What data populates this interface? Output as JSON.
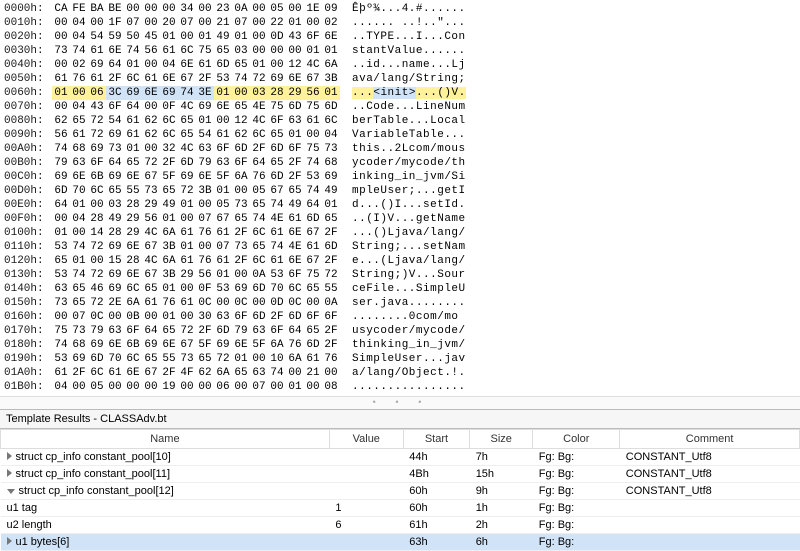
{
  "hex": {
    "rows": [
      {
        "addr": "0000h:",
        "bytes": [
          "CA",
          "FE",
          "BA",
          "BE",
          "00",
          "00",
          "00",
          "34",
          "00",
          "23",
          "0A",
          "00",
          "05",
          "00",
          "1E",
          "09"
        ],
        "ascii": "Êþº¾...4.#......",
        "hl": []
      },
      {
        "addr": "0010h:",
        "bytes": [
          "00",
          "04",
          "00",
          "1F",
          "07",
          "00",
          "20",
          "07",
          "00",
          "21",
          "07",
          "00",
          "22",
          "01",
          "00",
          "02"
        ],
        "ascii": "...... ..!..\"...",
        "hl": []
      },
      {
        "addr": "0020h:",
        "bytes": [
          "00",
          "04",
          "54",
          "59",
          "50",
          "45",
          "01",
          "00",
          "01",
          "49",
          "01",
          "00",
          "0D",
          "43",
          "6F",
          "6E"
        ],
        "ascii": "..TYPE...I...Con",
        "hl": []
      },
      {
        "addr": "0030h:",
        "bytes": [
          "73",
          "74",
          "61",
          "6E",
          "74",
          "56",
          "61",
          "6C",
          "75",
          "65",
          "03",
          "00",
          "00",
          "00",
          "01",
          "01"
        ],
        "ascii": "stantValue......",
        "hl": []
      },
      {
        "addr": "0040h:",
        "bytes": [
          "00",
          "02",
          "69",
          "64",
          "01",
          "00",
          "04",
          "6E",
          "61",
          "6D",
          "65",
          "01",
          "00",
          "12",
          "4C",
          "6A"
        ],
        "ascii": "..id...name...Lj",
        "hl": []
      },
      {
        "addr": "0050h:",
        "bytes": [
          "61",
          "76",
          "61",
          "2F",
          "6C",
          "61",
          "6E",
          "67",
          "2F",
          "53",
          "74",
          "72",
          "69",
          "6E",
          "67",
          "3B"
        ],
        "ascii": "ava/lang/String;",
        "hl": []
      },
      {
        "addr": "0060h:",
        "bytes": [
          "01",
          "00",
          "06",
          "3C",
          "69",
          "6E",
          "69",
          "74",
          "3E",
          "01",
          "00",
          "03",
          "28",
          "29",
          "56",
          "01"
        ],
        "ascii": "...<init>...()V.",
        "hl": [
          {
            "cls": "hl-yellow",
            "from": 0,
            "to": 15
          },
          {
            "cls": "hl-blue",
            "from": 3,
            "to": 8
          }
        ],
        "ascii_hl": [
          {
            "cls": "hl-yellow",
            "from": 0,
            "to": 15
          },
          {
            "cls": "hl-blue",
            "from": 3,
            "to": 8
          }
        ]
      },
      {
        "addr": "0070h:",
        "bytes": [
          "00",
          "04",
          "43",
          "6F",
          "64",
          "00",
          "0F",
          "4C",
          "69",
          "6E",
          "65",
          "4E",
          "75",
          "6D",
          "75",
          "6D"
        ],
        "ascii": "..Code...LineNum",
        "hl": []
      },
      {
        "addr": "0080h:",
        "bytes": [
          "62",
          "65",
          "72",
          "54",
          "61",
          "62",
          "6C",
          "65",
          "01",
          "00",
          "12",
          "4C",
          "6F",
          "63",
          "61",
          "6C"
        ],
        "ascii": "berTable...Local",
        "hl": []
      },
      {
        "addr": "0090h:",
        "bytes": [
          "56",
          "61",
          "72",
          "69",
          "61",
          "62",
          "6C",
          "65",
          "54",
          "61",
          "62",
          "6C",
          "65",
          "01",
          "00",
          "04"
        ],
        "ascii": "VariableTable...",
        "hl": []
      },
      {
        "addr": "00A0h:",
        "bytes": [
          "74",
          "68",
          "69",
          "73",
          "01",
          "00",
          "32",
          "4C",
          "63",
          "6F",
          "6D",
          "2F",
          "6D",
          "6F",
          "75",
          "73"
        ],
        "ascii": "this..2Lcom/mous",
        "hl": []
      },
      {
        "addr": "00B0h:",
        "bytes": [
          "79",
          "63",
          "6F",
          "64",
          "65",
          "72",
          "2F",
          "6D",
          "79",
          "63",
          "6F",
          "64",
          "65",
          "2F",
          "74",
          "68"
        ],
        "ascii": "ycoder/mycode/th",
        "hl": []
      },
      {
        "addr": "00C0h:",
        "bytes": [
          "69",
          "6E",
          "6B",
          "69",
          "6E",
          "67",
          "5F",
          "69",
          "6E",
          "5F",
          "6A",
          "76",
          "6D",
          "2F",
          "53",
          "69"
        ],
        "ascii": "inking_in_jvm/Si",
        "hl": []
      },
      {
        "addr": "00D0h:",
        "bytes": [
          "6D",
          "70",
          "6C",
          "65",
          "55",
          "73",
          "65",
          "72",
          "3B",
          "01",
          "00",
          "05",
          "67",
          "65",
          "74",
          "49"
        ],
        "ascii": "mpleUser;...getI",
        "hl": []
      },
      {
        "addr": "00E0h:",
        "bytes": [
          "64",
          "01",
          "00",
          "03",
          "28",
          "29",
          "49",
          "01",
          "00",
          "05",
          "73",
          "65",
          "74",
          "49",
          "64",
          "01"
        ],
        "ascii": "d...()I...setId.",
        "hl": []
      },
      {
        "addr": "00F0h:",
        "bytes": [
          "00",
          "04",
          "28",
          "49",
          "29",
          "56",
          "01",
          "00",
          "07",
          "67",
          "65",
          "74",
          "4E",
          "61",
          "6D",
          "65"
        ],
        "ascii": "..(I)V...getName",
        "hl": []
      },
      {
        "addr": "0100h:",
        "bytes": [
          "01",
          "00",
          "14",
          "28",
          "29",
          "4C",
          "6A",
          "61",
          "76",
          "61",
          "2F",
          "6C",
          "61",
          "6E",
          "67",
          "2F"
        ],
        "ascii": "...()Ljava/lang/",
        "hl": []
      },
      {
        "addr": "0110h:",
        "bytes": [
          "53",
          "74",
          "72",
          "69",
          "6E",
          "67",
          "3B",
          "01",
          "00",
          "07",
          "73",
          "65",
          "74",
          "4E",
          "61",
          "6D"
        ],
        "ascii": "String;...setNam",
        "hl": []
      },
      {
        "addr": "0120h:",
        "bytes": [
          "65",
          "01",
          "00",
          "15",
          "28",
          "4C",
          "6A",
          "61",
          "76",
          "61",
          "2F",
          "6C",
          "61",
          "6E",
          "67",
          "2F"
        ],
        "ascii": "e...(Ljava/lang/",
        "hl": []
      },
      {
        "addr": "0130h:",
        "bytes": [
          "53",
          "74",
          "72",
          "69",
          "6E",
          "67",
          "3B",
          "29",
          "56",
          "01",
          "00",
          "0A",
          "53",
          "6F",
          "75",
          "72"
        ],
        "ascii": "String;)V...Sour",
        "hl": []
      },
      {
        "addr": "0140h:",
        "bytes": [
          "63",
          "65",
          "46",
          "69",
          "6C",
          "65",
          "01",
          "00",
          "0F",
          "53",
          "69",
          "6D",
          "70",
          "6C",
          "65",
          "55"
        ],
        "ascii": "ceFile...SimpleU",
        "hl": []
      },
      {
        "addr": "0150h:",
        "bytes": [
          "73",
          "65",
          "72",
          "2E",
          "6A",
          "61",
          "76",
          "61",
          "0C",
          "00",
          "0C",
          "00",
          "0D",
          "0C",
          "00",
          "0A"
        ],
        "ascii": "ser.java........",
        "hl": []
      },
      {
        "addr": "0160h:",
        "bytes": [
          "00",
          "07",
          "0C",
          "00",
          "0B",
          "00",
          "01",
          "00",
          "30",
          "63",
          "6F",
          "6D",
          "2F",
          "6D",
          "6F",
          "6F"
        ],
        "ascii": "........0com/mo",
        "hl": []
      },
      {
        "addr": "0170h:",
        "bytes": [
          "75",
          "73",
          "79",
          "63",
          "6F",
          "64",
          "65",
          "72",
          "2F",
          "6D",
          "79",
          "63",
          "6F",
          "64",
          "65",
          "2F"
        ],
        "ascii": "usycoder/mycode/",
        "hl": []
      },
      {
        "addr": "0180h:",
        "bytes": [
          "74",
          "68",
          "69",
          "6E",
          "6B",
          "69",
          "6E",
          "67",
          "5F",
          "69",
          "6E",
          "5F",
          "6A",
          "76",
          "6D",
          "2F"
        ],
        "ascii": "thinking_in_jvm/",
        "hl": []
      },
      {
        "addr": "0190h:",
        "bytes": [
          "53",
          "69",
          "6D",
          "70",
          "6C",
          "65",
          "55",
          "73",
          "65",
          "72",
          "01",
          "00",
          "10",
          "6A",
          "61",
          "76"
        ],
        "ascii": "SimpleUser...jav",
        "hl": []
      },
      {
        "addr": "01A0h:",
        "bytes": [
          "61",
          "2F",
          "6C",
          "61",
          "6E",
          "67",
          "2F",
          "4F",
          "62",
          "6A",
          "65",
          "63",
          "74",
          "00",
          "21",
          "00"
        ],
        "ascii": "a/lang/Object.!.",
        "hl": []
      },
      {
        "addr": "01B0h:",
        "bytes": [
          "04",
          "00",
          "05",
          "00",
          "00",
          "00",
          "19",
          "00",
          "00",
          "06",
          "00",
          "07",
          "00",
          "01",
          "00",
          "08"
        ],
        "ascii": "................",
        "hl": []
      }
    ]
  },
  "template": {
    "title": "Template Results - CLASSAdv.bt",
    "columns": [
      "Name",
      "Value",
      "Start",
      "Size",
      "Color",
      "Comment"
    ],
    "rows": [
      {
        "name": "struct cp_info constant_pool[10]",
        "value": "",
        "start": "44h",
        "size": "7h",
        "fg": "Fg:",
        "bg": "Bg:",
        "comment": "CONSTANT_Utf8",
        "toggle": "closed",
        "indent": 1,
        "selected": false
      },
      {
        "name": "struct cp_info constant_pool[11]",
        "value": "",
        "start": "4Bh",
        "size": "15h",
        "fg": "Fg:",
        "bg": "Bg:",
        "comment": "CONSTANT_Utf8",
        "toggle": "closed",
        "indent": 1,
        "selected": false
      },
      {
        "name": "struct cp_info constant_pool[12]",
        "value": "",
        "start": "60h",
        "size": "9h",
        "fg": "Fg:",
        "bg": "Bg:",
        "comment": "CONSTANT_Utf8",
        "toggle": "open",
        "indent": 1,
        "selected": false
      },
      {
        "name": "u1 tag",
        "value": "1",
        "start": "60h",
        "size": "1h",
        "fg": "Fg:",
        "bg": "Bg:",
        "comment": "",
        "toggle": "",
        "indent": 2,
        "selected": false
      },
      {
        "name": "u2 length",
        "value": "6",
        "start": "61h",
        "size": "2h",
        "fg": "Fg:",
        "bg": "Bg:",
        "comment": "",
        "toggle": "",
        "indent": 2,
        "selected": false
      },
      {
        "name": "u1 bytes[6]",
        "value": "",
        "start": "63h",
        "size": "6h",
        "fg": "Fg:",
        "bg": "Bg:",
        "comment": "",
        "toggle": "closed",
        "indent": 2,
        "selected": true
      }
    ]
  }
}
